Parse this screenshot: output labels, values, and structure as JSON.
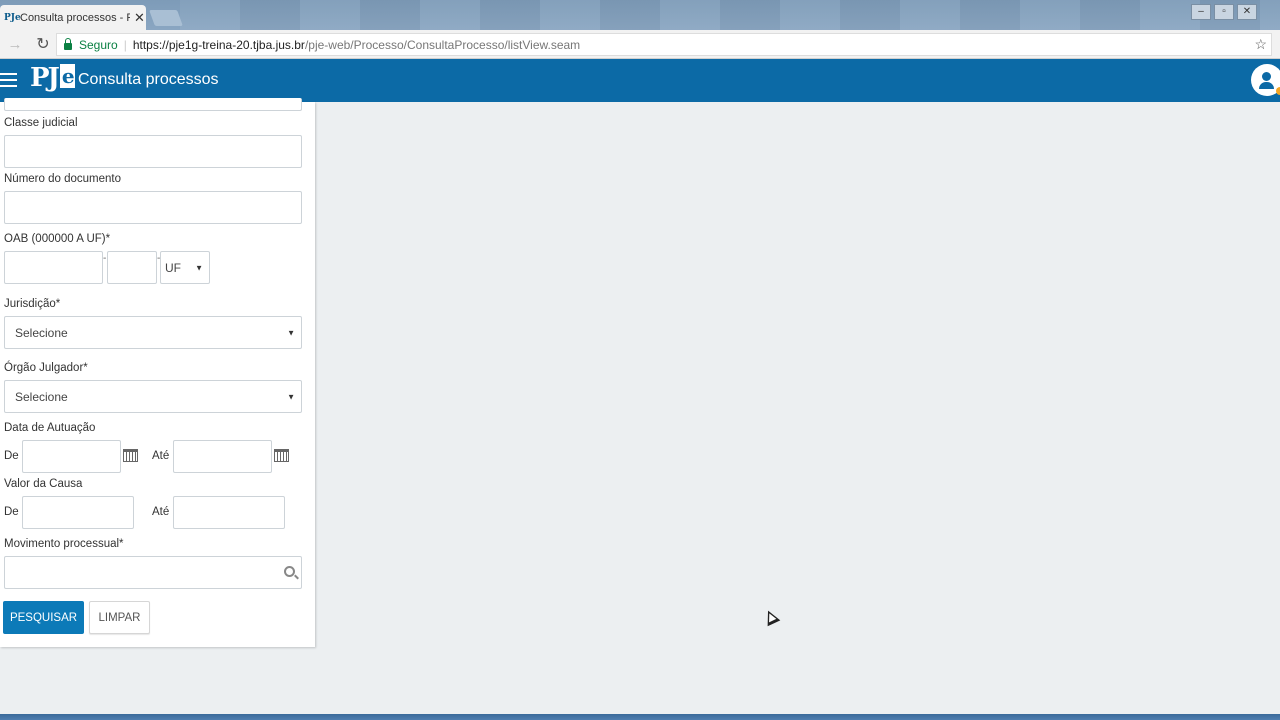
{
  "browser": {
    "tab_title": "Consulta processos - Proc",
    "tab_favicon": "PJe",
    "close_glyph": "✕",
    "secure_label": "Seguro",
    "url_host": "https://pje1g-treina-20.tjba.jus.br",
    "url_path": "/pje-web/Processo/ConsultaProcesso/listView.seam",
    "icons": [
      "back-arrow-icon",
      "forward-arrow-icon",
      "reload-icon",
      "lock-icon",
      "bookmark-star-icon",
      "minimize-icon",
      "restore-icon",
      "close-icon"
    ]
  },
  "app": {
    "logo_main": "PJ",
    "logo_e": "e",
    "title": "Consulta processos",
    "brand_color": "#0c6aa6"
  },
  "form": {
    "classe_label": "Classe judicial",
    "numero_doc_label": "Número do documento",
    "oab_label": "OAB (000000 A UF)*",
    "oab_uf_value": "UF",
    "jurisdicao_label": "Jurisdição*",
    "jurisdicao_value": "Selecione",
    "orgao_label": "Órgão Julgador*",
    "orgao_value": "Selecione",
    "data_label": "Data de Autuação",
    "valor_label": "Valor da Causa",
    "de_label": "De",
    "ate_label": "Até",
    "movimento_label": "Movimento processual*",
    "search_button": "PESQUISAR",
    "clear_button": "LIMPAR",
    "primary_color": "#0c7ab8"
  }
}
